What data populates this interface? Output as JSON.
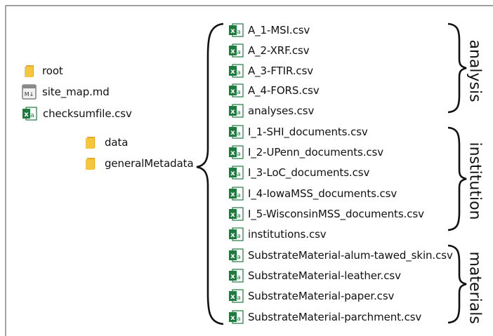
{
  "left_tree": {
    "root": "root",
    "site_map": "site_map.md",
    "checksum": "checksumfile.csv",
    "data": "data",
    "general_metadata": "generalMetadata"
  },
  "files": [
    "A_1-MSI.csv",
    "A_2-XRF.csv",
    "A_3-FTIR.csv",
    "A_4-FORS.csv",
    "analyses.csv",
    "I_1-SHI_documents.csv",
    "I_2-UPenn_documents.csv",
    "I_3-LoC_documents.csv",
    "I_4-IowaMSS_documents.csv",
    "I_5-WisconsinMSS_documents.csv",
    "institutions.csv",
    "SubstrateMaterial-alum-tawed_skin.csv",
    "SubstrateMaterial-leather.csv",
    "SubstrateMaterial-paper.csv",
    "SubstrateMaterial-parchment.csv"
  ],
  "groups": {
    "analysis": "analysis",
    "institution": "institution",
    "materials": "materials"
  },
  "icons": {
    "folder": "folder-icon",
    "markdown": "markdown-file-icon",
    "excel": "excel-csv-icon"
  },
  "colors": {
    "folder": "#f4c43a",
    "excel": "#1f7a3e",
    "border": "#555555"
  }
}
